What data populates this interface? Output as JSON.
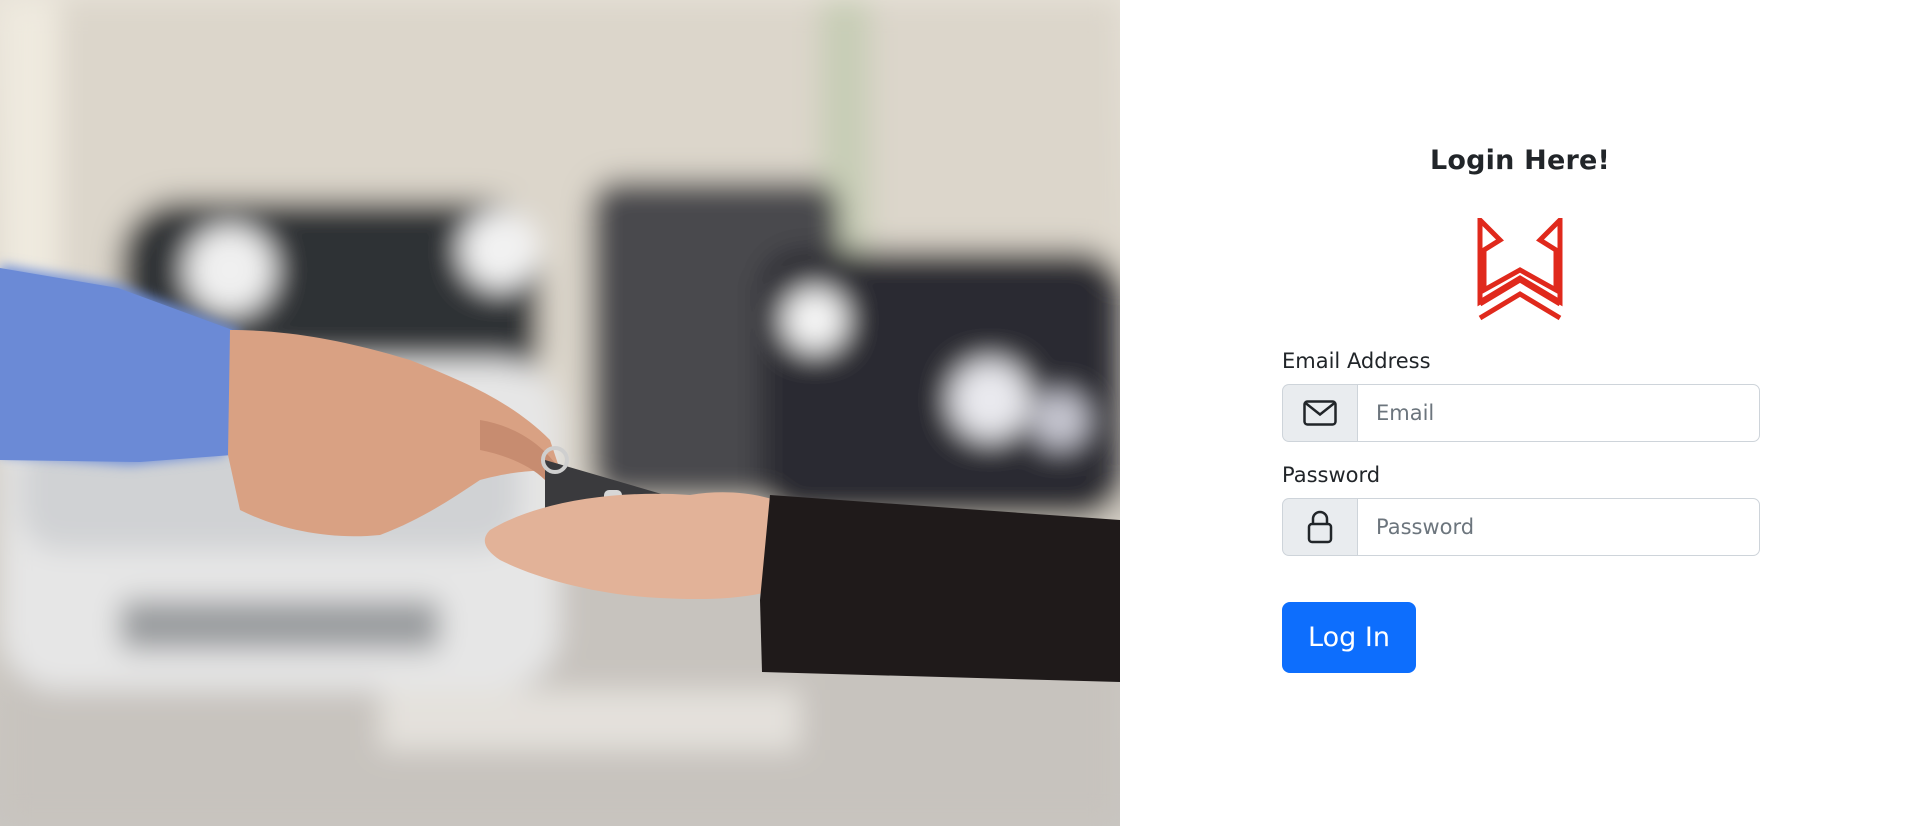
{
  "hero": {
    "image": "hand-handing-car-key-fob-in-parking-garage"
  },
  "login": {
    "title": "Login Here!",
    "logo": "w-brand-logo",
    "brand_color": "#e0291c",
    "email": {
      "label": "Email Address",
      "placeholder": "Email",
      "value": "",
      "icon": "envelope-icon"
    },
    "password": {
      "label": "Password",
      "placeholder": "Password",
      "value": "",
      "icon": "lock-icon"
    },
    "submit_label": "Log In",
    "accent_color": "#0d6efd"
  }
}
